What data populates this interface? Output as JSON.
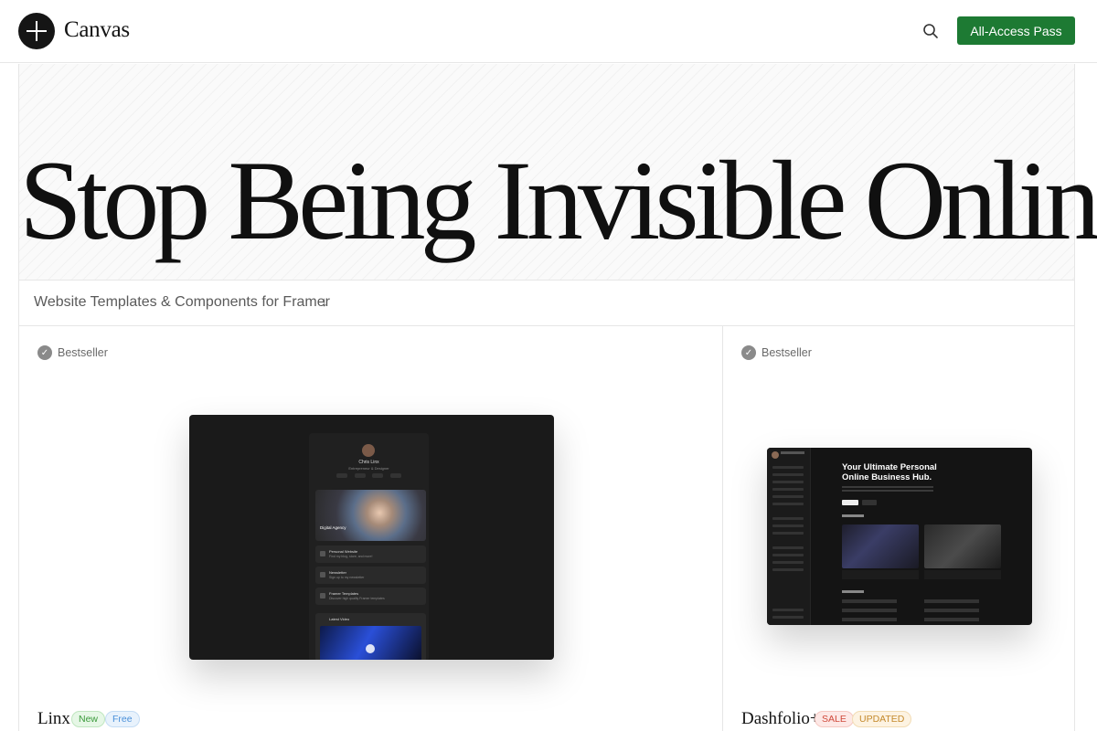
{
  "header": {
    "brand": "Canvas",
    "cta_label": "All-Access Pass"
  },
  "hero": {
    "title": "Stop Being Invisible Online"
  },
  "subtitle": {
    "text": "Website Templates & Components for Framer",
    "arrow": "↓"
  },
  "cards": [
    {
      "tag": "Bestseller",
      "name": "Linx",
      "badges": [
        "New",
        "Free"
      ],
      "preview": {
        "profile_name": "Chris Linx",
        "profile_role": "Entrepreneur & Designer",
        "hero_caption": "Digital Agency",
        "items": [
          {
            "title": "Personal Website",
            "sub": "Find my blog, store, and more!"
          },
          {
            "title": "Newsletter",
            "sub": "Sign up to my newsletter"
          },
          {
            "title": "Framer Templates",
            "sub": "Discover high quality Framer templates"
          }
        ],
        "video_title": "Latest Video"
      }
    },
    {
      "tag": "Bestseller",
      "name": "Dashfolio+",
      "badges": [
        "SALE",
        "UPDATED"
      ],
      "preview": {
        "title_line1": "Your Ultimate Personal",
        "title_line2": "Online Business Hub."
      }
    }
  ],
  "colors": {
    "cta": "#1d7a33",
    "badge_new": "#3b9a3b",
    "badge_free": "#4a90d9",
    "badge_sale": "#d04a3c",
    "badge_updated": "#c48a2c"
  }
}
